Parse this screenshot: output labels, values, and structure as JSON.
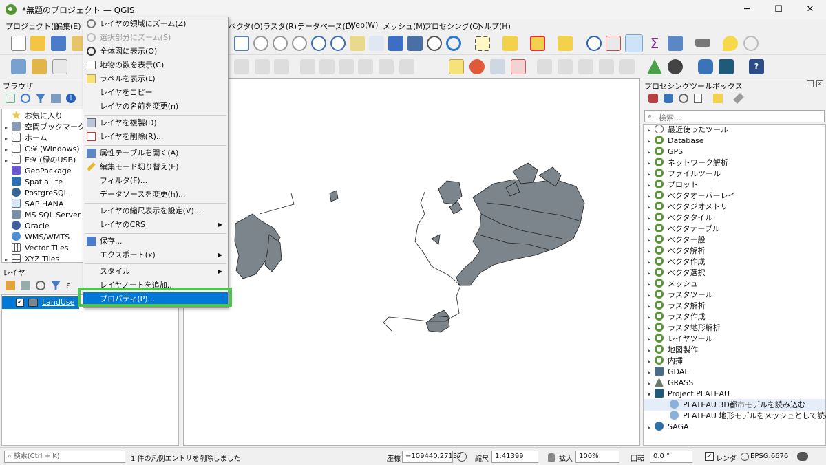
{
  "window": {
    "title": "*無題のプロジェクト — QGIS",
    "minimize": "─",
    "maximize": "☐",
    "close": "✕"
  },
  "menubar": [
    {
      "label": "プロジェクト(J)"
    },
    {
      "label": "編集(E)"
    },
    {
      "label": "ベクタ(O)"
    },
    {
      "label": "ラスタ(R)"
    },
    {
      "label": "データベース(D)"
    },
    {
      "label": "Web(W)"
    },
    {
      "label": "メッシュ(M)"
    },
    {
      "label": "プロセシング(C)"
    },
    {
      "label": "ヘルプ(H)"
    }
  ],
  "browser": {
    "title": "ブラウザ",
    "items": [
      {
        "label": "お気に入り",
        "icon": "star-icon"
      },
      {
        "label": "空間ブックマーク",
        "icon": "bookmark-icon"
      },
      {
        "label": "ホーム",
        "icon": "home-icon"
      },
      {
        "label": "C:¥ (Windows)",
        "icon": "folder-icon"
      },
      {
        "label": "E:¥ (緑のUSB)",
        "icon": "folder-icon"
      },
      {
        "label": "GeoPackage",
        "icon": "geopackage-icon"
      },
      {
        "label": "SpatiaLite",
        "icon": "spatialite-icon"
      },
      {
        "label": "PostgreSQL",
        "icon": "postgresql-icon"
      },
      {
        "label": "SAP HANA",
        "icon": "sap-hana-icon"
      },
      {
        "label": "MS SQL Server",
        "icon": "mssql-icon"
      },
      {
        "label": "Oracle",
        "icon": "oracle-icon"
      },
      {
        "label": "WMS/WMTS",
        "icon": "wms-icon"
      },
      {
        "label": "Vector Tiles",
        "icon": "vector-tiles-icon"
      },
      {
        "label": "XYZ Tiles",
        "icon": "xyz-tiles-icon"
      }
    ]
  },
  "layers": {
    "title": "レイヤ",
    "items": [
      {
        "label": "LandUse",
        "checked": true
      }
    ]
  },
  "context_menu": {
    "items": [
      {
        "label": "レイヤの領域にズーム(Z)",
        "icon": "zoom-layer-icon",
        "enabled": true
      },
      {
        "label": "選択部分にズーム(S)",
        "icon": "zoom-selection-icon",
        "enabled": false
      },
      {
        "label": "全体図に表示(O)",
        "icon": "overview-icon",
        "enabled": true
      },
      {
        "label": "地物の数を表示(C)",
        "icon": "checkbox-icon",
        "enabled": true
      },
      {
        "label": "ラベルを表示(L)",
        "icon": "label-icon",
        "enabled": true
      },
      {
        "label": "レイヤをコピー",
        "icon": "",
        "enabled": true
      },
      {
        "label": "レイヤの名前を変更(n)",
        "icon": "",
        "enabled": true
      },
      {
        "label": "レイヤを複製(D)",
        "icon": "duplicate-icon",
        "enabled": true
      },
      {
        "label": "レイヤを削除(R)...",
        "icon": "remove-layer-icon",
        "enabled": true
      },
      {
        "label": "属性テーブルを開く(A)",
        "icon": "attribute-table-icon",
        "enabled": true
      },
      {
        "label": "編集モード切り替え(E)",
        "icon": "pencil-icon",
        "enabled": true
      },
      {
        "label": "フィルタ(F)...",
        "icon": "",
        "enabled": true
      },
      {
        "label": "データソースを変更(h)...",
        "icon": "",
        "enabled": true
      },
      {
        "label": "レイヤの縮尺表示を設定(V)...",
        "icon": "",
        "enabled": true
      },
      {
        "label": "レイヤのCRS",
        "icon": "",
        "enabled": true,
        "submenu": true
      },
      {
        "label": "保存...",
        "icon": "save-icon",
        "enabled": true
      },
      {
        "label": "エクスポート(x)",
        "icon": "",
        "enabled": true,
        "submenu": true
      },
      {
        "label": "スタイル",
        "icon": "",
        "enabled": true,
        "submenu": true
      },
      {
        "label": "レイヤノートを追加...",
        "icon": "",
        "enabled": true
      },
      {
        "label": "プロパティ(P)...",
        "icon": "",
        "enabled": true,
        "highlighted": true
      }
    ]
  },
  "processing": {
    "title": "プロセシングツールボックス",
    "search_placeholder": "検索...",
    "items": [
      {
        "label": "最近使ったツール",
        "icon": "clock-icon"
      },
      {
        "label": "Database",
        "icon": "qgis-icon"
      },
      {
        "label": "GPS",
        "icon": "qgis-icon"
      },
      {
        "label": "ネットワーク解析",
        "icon": "qgis-icon"
      },
      {
        "label": "ファイルツール",
        "icon": "qgis-icon"
      },
      {
        "label": "プロット",
        "icon": "qgis-icon"
      },
      {
        "label": "ベクタオーバーレイ",
        "icon": "qgis-icon"
      },
      {
        "label": "ベクタジオメトリ",
        "icon": "qgis-icon"
      },
      {
        "label": "ベクタタイル",
        "icon": "qgis-icon"
      },
      {
        "label": "ベクタテーブル",
        "icon": "qgis-icon"
      },
      {
        "label": "ベクター般",
        "icon": "qgis-icon"
      },
      {
        "label": "ベクタ解析",
        "icon": "qgis-icon"
      },
      {
        "label": "ベクタ作成",
        "icon": "qgis-icon"
      },
      {
        "label": "ベクタ選択",
        "icon": "qgis-icon"
      },
      {
        "label": "メッシュ",
        "icon": "qgis-icon"
      },
      {
        "label": "ラスタツール",
        "icon": "qgis-icon"
      },
      {
        "label": "ラスタ解析",
        "icon": "qgis-icon"
      },
      {
        "label": "ラスタ作成",
        "icon": "qgis-icon"
      },
      {
        "label": "ラスタ地形解析",
        "icon": "qgis-icon"
      },
      {
        "label": "レイヤツール",
        "icon": "qgis-icon"
      },
      {
        "label": "地図製作",
        "icon": "qgis-icon"
      },
      {
        "label": "内挿",
        "icon": "qgis-icon"
      },
      {
        "label": "GDAL",
        "icon": "gdal-icon"
      },
      {
        "label": "GRASS",
        "icon": "grass-icon"
      },
      {
        "label": "Project PLATEAU",
        "icon": "plateau-icon",
        "expanded": true
      },
      {
        "label": "PLATEAU 3D都市モデルを読み込む",
        "icon": "gear-icon",
        "child": true
      },
      {
        "label": "PLATEAU 地形モデルをメッシュとして読み込む",
        "icon": "gear-icon",
        "child": true
      },
      {
        "label": "SAGA",
        "icon": "saga-icon"
      }
    ]
  },
  "statusbar": {
    "search_placeholder": "検索(Ctrl + K)",
    "message": "1 件の凡例エントリを削除しました",
    "coord_label": "座標",
    "coord_value": "−109440,27137",
    "scale_label": "縮尺",
    "scale_value": "1:41399",
    "magnifier_label": "拡大",
    "magnifier_value": "100%",
    "rotation_label": "回転",
    "rotation_value": "0.0 °",
    "render_label": "レンダ",
    "crs": "EPSG:6676"
  },
  "colors": {
    "accent_select": "#0078d7",
    "highlight_box": "#4ec54e",
    "map_polygon": "#7c858c",
    "qgis_green": "#589632"
  }
}
